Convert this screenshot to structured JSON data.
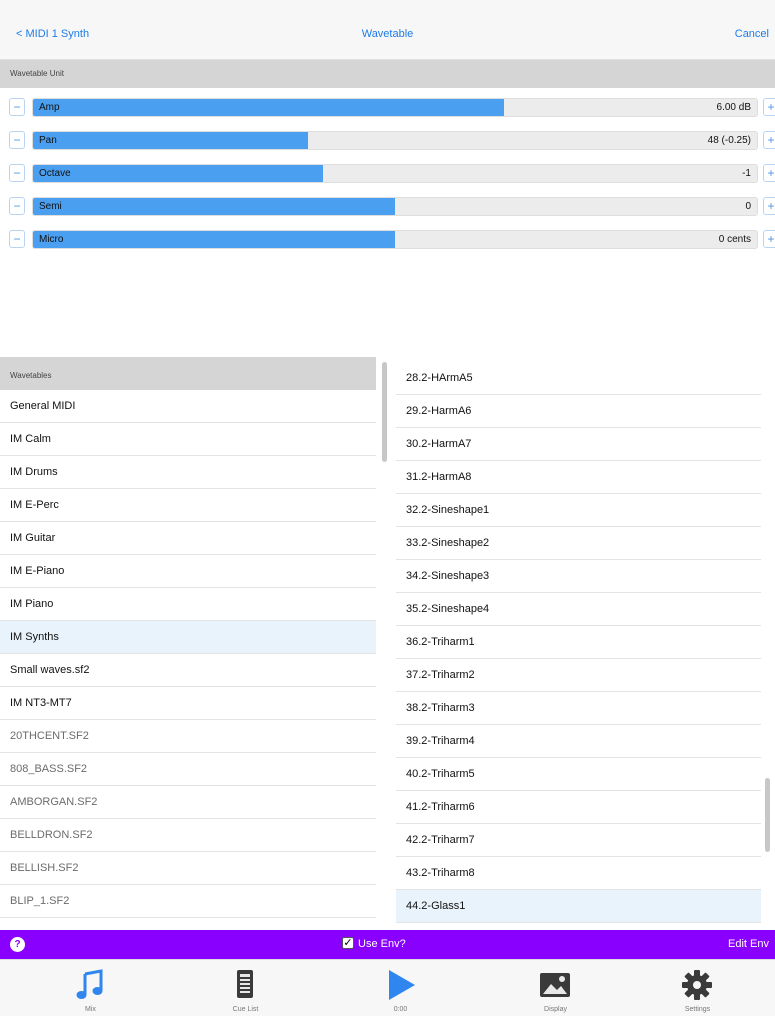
{
  "nav": {
    "back_label": "< MIDI 1 Synth",
    "title": "Wavetable",
    "cancel_label": "Cancel"
  },
  "unit_section": {
    "title": "Wavetable Unit"
  },
  "params": [
    {
      "label": "Amp",
      "value": "6.00 dB",
      "level": 0.65
    },
    {
      "label": "Pan",
      "value": "48 (-0.25)",
      "level": 0.38
    },
    {
      "label": "Octave",
      "value": "-1",
      "level": 0.4
    },
    {
      "label": "Semi",
      "value": "0",
      "level": 0.5
    },
    {
      "label": "Micro",
      "value": "0 cents",
      "level": 0.5
    }
  ],
  "wavetables": {
    "title": "Wavetables",
    "items": [
      "General MIDI",
      "IM Calm",
      "IM Drums",
      "IM E-Perc",
      "IM Guitar",
      "IM E-Piano",
      "IM Piano",
      "IM Synths",
      "Small waves.sf2",
      "IM NT3-MT7",
      "20THCENT.SF2",
      "808_BASS.SF2",
      "AMBORGAN.SF2",
      "BELLDRON.SF2",
      "BELLISH.SF2",
      "BLIP_1.SF2"
    ],
    "selected": "IM Synths"
  },
  "waves": {
    "items": [
      "28.2-HArmA5",
      "29.2-HarmA6",
      "30.2-HarmA7",
      "31.2-HarmA8",
      "32.2-Sineshape1",
      "33.2-Sineshape2",
      "34.2-Sineshape3",
      "35.2-Sineshape4",
      "36.2-Triharm1",
      "37.2-Triharm2",
      "38.2-Triharm3",
      "39.2-Triharm4",
      "40.2-Triharm5",
      "41.2-Triharm6",
      "42.2-Triharm7",
      "43.2-Triharm8",
      "44.2-Glass1"
    ],
    "selected": "44.2-Glass1"
  },
  "envbar": {
    "help_icon": "?",
    "use_env_label": "Use Env?",
    "use_env_checked": true,
    "edit_env_label": "Edit Env"
  },
  "tabs": [
    {
      "label": "Mix",
      "icon": "music-note-icon"
    },
    {
      "label": "Cue List",
      "icon": "cue-list-icon"
    },
    {
      "label": "0:00",
      "icon": "play-icon"
    },
    {
      "label": "Display",
      "icon": "image-icon"
    },
    {
      "label": "Settings",
      "icon": "gear-icon"
    }
  ],
  "colors": {
    "accent": "#1e7ce8",
    "slider_fill": "#4a9ff0",
    "env_bar": "#8a00ff",
    "selected_row": "#e8f3fb"
  }
}
